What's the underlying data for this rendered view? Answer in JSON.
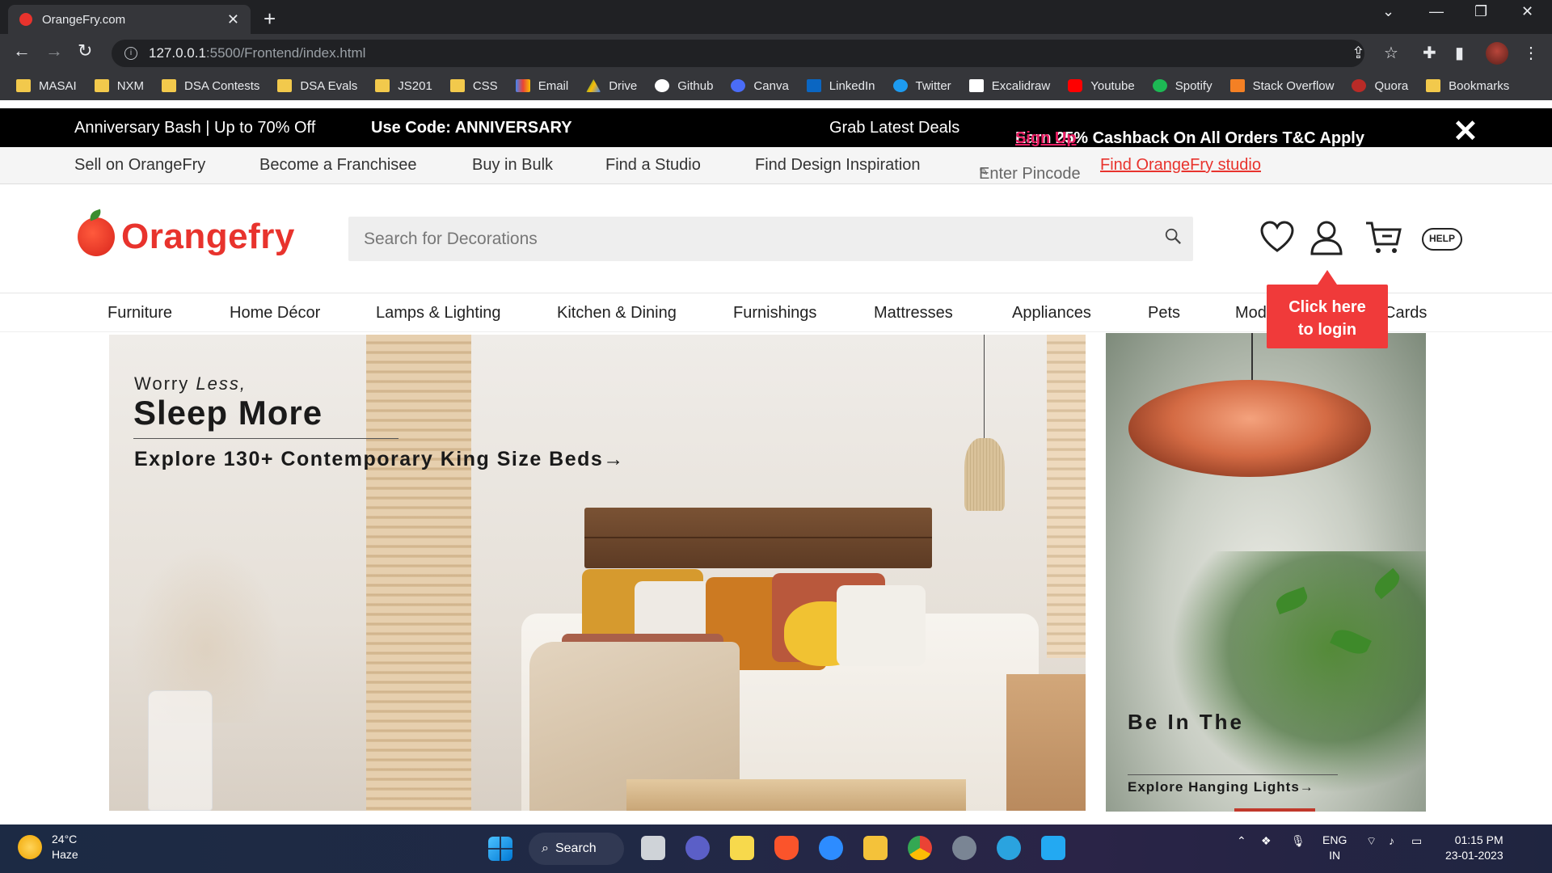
{
  "browser": {
    "tab_title": "OrangeFry.com",
    "url_host": "127.0.0.1",
    "url_rest": ":5500/Frontend/index.html",
    "bookmarks": [
      "MASAI",
      "NXM",
      "DSA Contests",
      "DSA Evals",
      "JS201",
      "CSS",
      "Email",
      "Drive",
      "Github",
      "Canva",
      "LinkedIn",
      "Twitter",
      "Excalidraw",
      "Youtube",
      "Spotify",
      "Stack Overflow",
      "Quora",
      "Bookmarks"
    ]
  },
  "promo": {
    "deal": "Anniversary Bash | Up to 70% Off",
    "code": "Use Code: ANNIVERSARY",
    "grab": "Grab Latest Deals",
    "cashback": "Earn 25% Cashback On All Orders T&C Apply",
    "signup": "Sign Up"
  },
  "utility": {
    "sell": "Sell on OrangeFry",
    "franchise": "Become a Franchisee",
    "bulk": "Buy in Bulk",
    "studio": "Find a Studio",
    "inspiration": "Find Design Inspiration",
    "pincode": "Enter Pincode",
    "find_studio": "Find OrangeFry studio"
  },
  "header": {
    "brand": "Orangefry",
    "search_placeholder": "Search for Decorations",
    "help": "HELP"
  },
  "categories": [
    "Furniture",
    "Home Décor",
    "Lamps & Lighting",
    "Kitchen & Dining",
    "Furnishings",
    "Mattresses",
    "Appliances",
    "Pets",
    "Mod",
    "Cards"
  ],
  "tooltip": {
    "line1": "Click here",
    "line2": "to login"
  },
  "banner_main": {
    "line1_a": "Worry ",
    "line1_b": "Less,",
    "headline": "Sleep More",
    "cta": "Explore 130+ Contemporary King Size Beds→"
  },
  "banner_side": {
    "headline": "Be In The",
    "cta": "Explore Hanging Lights→"
  },
  "taskbar": {
    "temp": "24°C",
    "weather": "Haze",
    "search": "Search",
    "lang1": "ENG",
    "lang2": "IN",
    "time": "01:15 PM",
    "date": "23-01-2023"
  },
  "colors": {
    "brand": "#e8332d",
    "signup": "#e91e63",
    "tooltip": "#f03a3a"
  }
}
